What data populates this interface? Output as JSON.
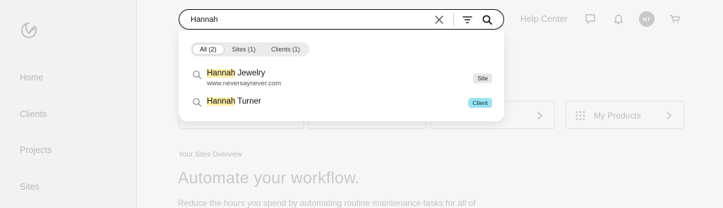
{
  "sidebar": {
    "items": [
      {
        "label": "Home"
      },
      {
        "label": "Clients"
      },
      {
        "label": "Projects"
      },
      {
        "label": "Sites"
      }
    ]
  },
  "header": {
    "help_center": "Help Center",
    "avatar_initials": "NT",
    "icons": [
      "chat-bubble-icon",
      "bell-icon",
      "cart-icon"
    ]
  },
  "search": {
    "value": "Hannah",
    "icons": [
      "clear-x-icon",
      "filter-icon",
      "search-icon"
    ]
  },
  "dropdown": {
    "tabs": [
      {
        "label": "All (2)",
        "active": true
      },
      {
        "label": "Sites (1)",
        "active": false
      },
      {
        "label": "Clients (1)",
        "active": false
      }
    ],
    "results": [
      {
        "highlight": "Hannah",
        "rest": " Jewelry",
        "subtitle": "www.neversaynever.com",
        "badge": "Site"
      },
      {
        "highlight": "Hannah",
        "rest": " Turner",
        "subtitle": "",
        "badge": "Client"
      }
    ]
  },
  "background": {
    "products_card": "My Products",
    "overview_label": "Your Sites Overview",
    "headline": "Automate your workflow.",
    "subline": "Reduce the hours you spend by automating routine maintenance tasks for all of"
  },
  "colors": {
    "highlight": "#fdeea6",
    "site_badge_bg": "#e6e6e6",
    "client_badge_bg": "#9be3f0"
  }
}
